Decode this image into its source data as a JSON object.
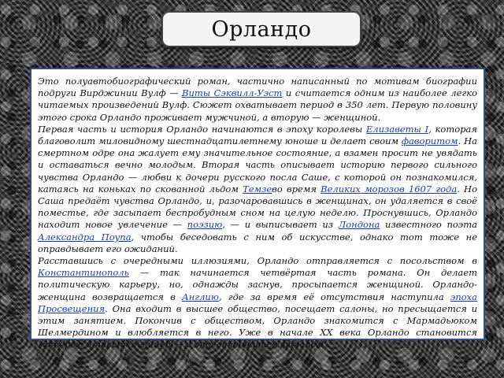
{
  "title": "Орландо",
  "paragraphs": [
    [
      {
        "t": "Это полуавтобиографический роман, частично написанный по мотивам биографии подруги Вирджинии Вулф — "
      },
      {
        "t": "Виты Сэквилл-Уэст",
        "link": true
      },
      {
        "t": " и считается одним из наиболее легко читаемых произведений Вулф. Сюжет охватывает период в 350 лет. Первую половину этого срока Орландо проживает мужчиной, а вторую — женщиной."
      }
    ],
    [
      {
        "t": "Первая часть и история Орландо начинаются в эпоху королевы "
      },
      {
        "t": "Елизаветы I",
        "link": true
      },
      {
        "t": ", которая благоволит миловидному шестнадцатилетнему юноше и делает своим "
      },
      {
        "t": "фаворитом",
        "link": true
      },
      {
        "t": ". На смертном одре она жалует ему значительное состояние, а взамен просит не увядать и оставаться вечно молодым. Вторая часть описывает историю первого сильного чувства Орландо — любви к дочери русского посла Саше, с которой он познакомился, катаясь на коньках по скованной льдом "
      },
      {
        "t": "Темзе",
        "link": true
      },
      {
        "t": "во время "
      },
      {
        "t": "Великих морозов 1607 года",
        "link": true
      },
      {
        "t": ". Но Саша предаёт чувства Орландо, и, разочаровавшись в женщинах, он удаляется в своё поместье, где засыпает беспробудным сном на целую неделю. Проснувшись, Орландо находит новое увлечение — "
      },
      {
        "t": "поэзию",
        "link": true
      },
      {
        "t": ", — и выписывает из "
      },
      {
        "t": "Лондона",
        "link": true
      },
      {
        "t": " известного поэта "
      },
      {
        "t": "Александра Поупа",
        "link": true
      },
      {
        "t": ", чтобы беседовать с ним об искусстве, однако тот тоже не оправдывает его ожиданий."
      }
    ],
    [
      {
        "t": "Расставшись с очередными иллюзиями, Орландо отправляется с посольством в "
      },
      {
        "t": "Константинополь",
        "link": true
      },
      {
        "t": " — так начинается четвёртая часть романа. Он делает политическую карьеру, но, однажды заснув, просыпается женщиной. Орландо-женщина возвращается в "
      },
      {
        "t": "Англию",
        "link": true
      },
      {
        "t": ", где за время её отсутствия наступила "
      },
      {
        "t": "эпоха Просвещения",
        "link": true
      },
      {
        "t": ". Она входит в высшее общество, посещает салоны, но пресыщается и этим занятием. Покончив с обществом, Орландо знакомится с Мармадьюком Шелмердином и влюбляется в него. Уже в начале XX века Орландо становится матерью и писательницей — и это становится финалом."
      }
    ]
  ]
}
